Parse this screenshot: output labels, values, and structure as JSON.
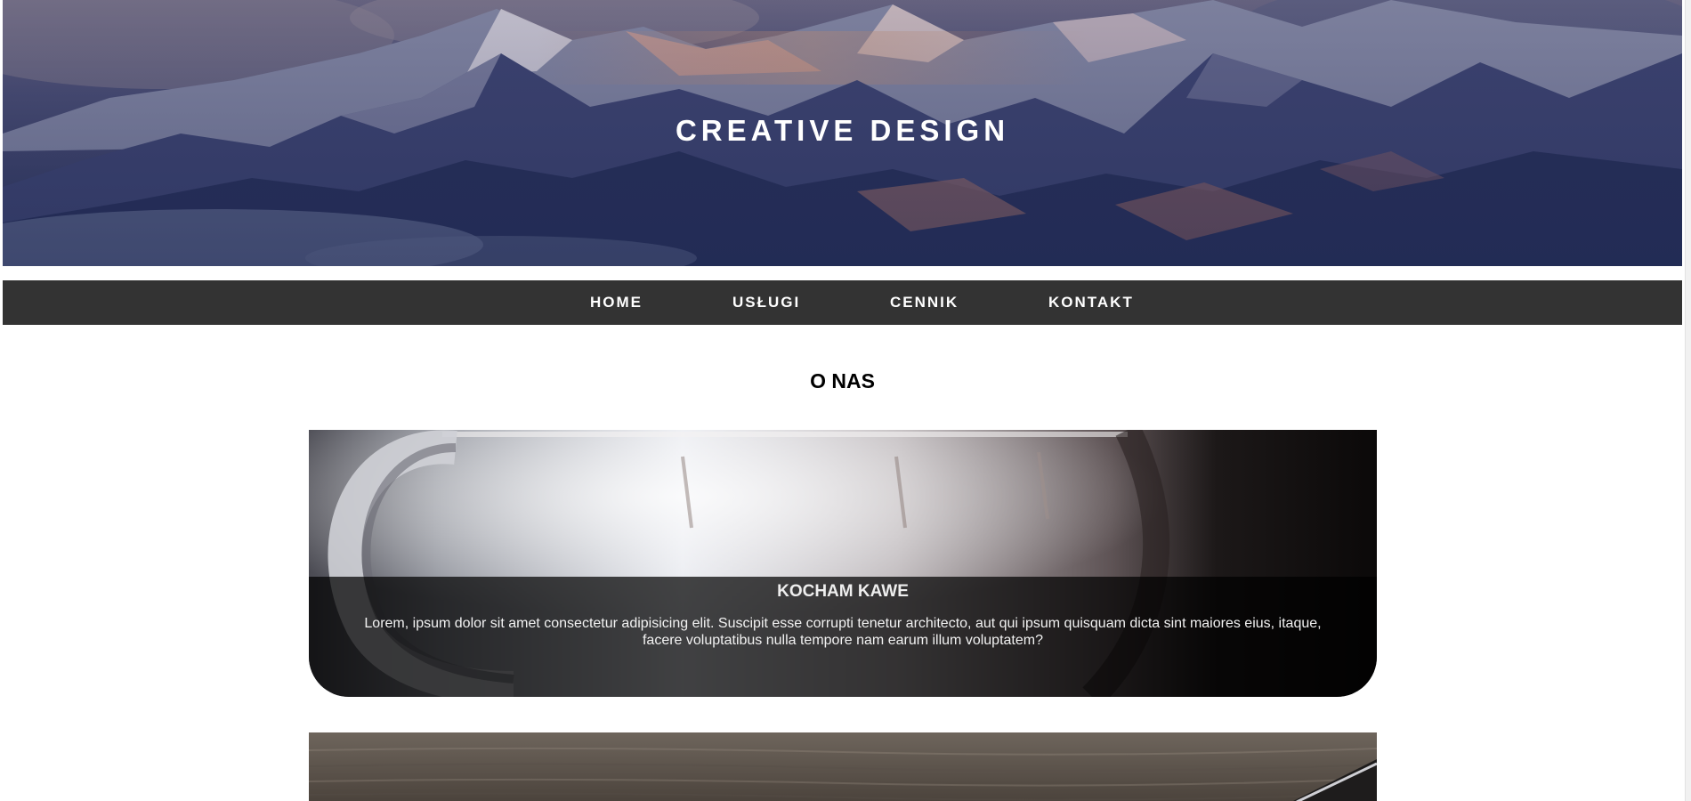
{
  "hero": {
    "title": "CREATIVE DESIGN",
    "background": "mountain-landscape-image"
  },
  "nav": {
    "items": [
      {
        "label": "HOME"
      },
      {
        "label": "USŁUGI"
      },
      {
        "label": "CENNIK"
      },
      {
        "label": "KONTAKT"
      }
    ]
  },
  "about": {
    "title": "O NAS",
    "cards": [
      {
        "image": "coffee-cup-image",
        "title": "KOCHAM KAWE",
        "text": "Lorem, ipsum dolor sit amet consectetur adipisicing elit. Suscipit esse corrupti tenetur architecto, aut qui ipsum quisquam dicta sint maiores eius, itaque, facere voluptatibus nulla tempore nam earum illum voluptatem?"
      },
      {
        "image": "wooden-desk-image"
      }
    ]
  },
  "colors": {
    "nav_background": "#333333",
    "hero_tint": "#2b3560",
    "text_light": "#ffffff"
  }
}
